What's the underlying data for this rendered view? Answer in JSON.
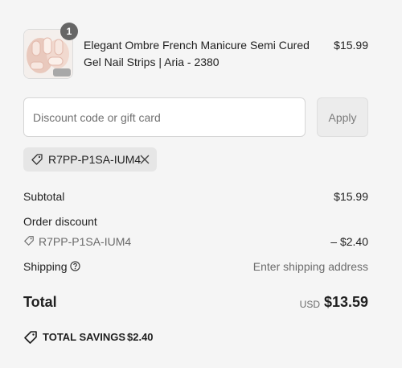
{
  "product": {
    "quantity": "1",
    "title": "Elegant Ombre French Manicure Semi Cured Gel Nail Strips | Aria - 2380",
    "price": "$15.99",
    "image_icon": "product-thumbnail"
  },
  "discount": {
    "placeholder": "Discount code or gift card",
    "value": "",
    "apply_label": "Apply",
    "applied_code": "R7PP-P1SA-IUM4"
  },
  "summary": {
    "subtotal_label": "Subtotal",
    "subtotal_value": "$15.99",
    "order_discount_label": "Order discount",
    "discount_code": "R7PP-P1SA-IUM4",
    "discount_value": "– $2.40",
    "shipping_label": "Shipping",
    "shipping_value": "Enter shipping address",
    "total_label": "Total",
    "total_currency": "USD",
    "total_value": "$13.59",
    "savings_label": "TOTAL SAVINGS",
    "savings_value": "$2.40"
  },
  "colors": {
    "background": "#f5f5f5",
    "badge": "#666666",
    "chip": "#e6e6e6"
  }
}
